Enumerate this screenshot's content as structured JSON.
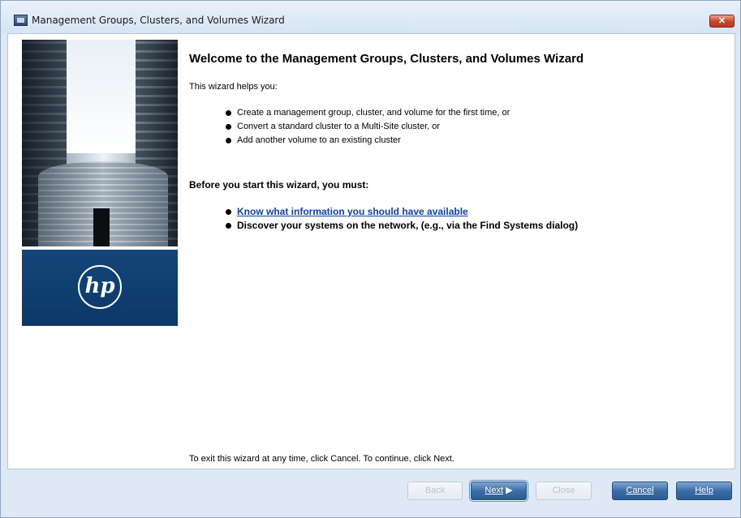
{
  "window": {
    "title": "Management Groups, Clusters, and Volumes Wizard",
    "close_label": "✕"
  },
  "branding": {
    "logo_text": "hp"
  },
  "content": {
    "heading": "Welcome to the Management Groups, Clusters, and Volumes Wizard",
    "intro": "This wizard helps you:",
    "helps": [
      "Create a management group, cluster, and volume for the first time, or",
      "Convert a standard cluster to a Multi-Site cluster, or",
      "Add another volume to an existing cluster"
    ],
    "before_heading": "Before you start this wizard, you must:",
    "before_items": {
      "link": "Know what information you should have available",
      "discover": "Discover your systems on the network, (e.g., via the Find Systems dialog)"
    },
    "exit_text": "To exit this wizard at any time, click Cancel. To continue, click Next."
  },
  "buttons": {
    "back": {
      "label": "Back",
      "enabled": false
    },
    "next": {
      "label": "Next",
      "enabled": true
    },
    "close": {
      "label": "Close",
      "enabled": false
    },
    "cancel": {
      "label": "Cancel",
      "enabled": true
    },
    "help": {
      "label": "Help",
      "enabled": true
    }
  },
  "colors": {
    "link": "#0b3fb8",
    "button_blue": "#3b6ea6",
    "hp_blue": "#0b3868"
  }
}
